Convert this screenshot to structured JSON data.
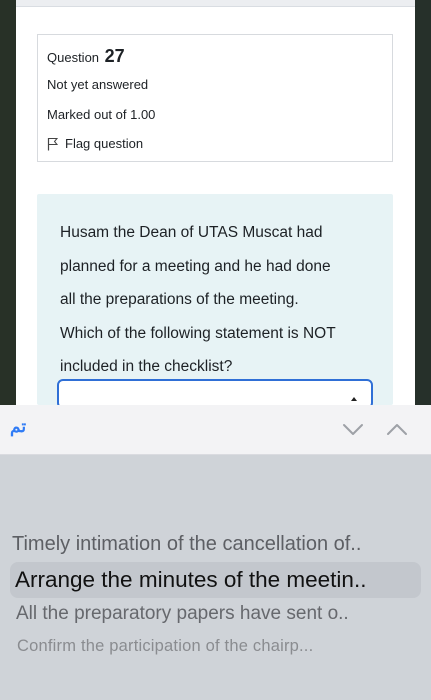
{
  "question": {
    "label": "Question",
    "number": "27",
    "status": "Not yet answered",
    "marks": "Marked out of 1.00",
    "flag_label": "Flag question",
    "text_lines": [
      "Husam the Dean of UTAS Muscat had",
      "planned for a meeting and he had done",
      "all the preparations of the meeting.",
      "Which of the following statement is NOT",
      "included in the checklist?"
    ]
  },
  "picker_toolbar": {
    "done_label": "تم",
    "prev_icon": "chevron-down-icon",
    "next_icon": "chevron-up-icon",
    "accent": "#2f7bf5"
  },
  "picker_options": [
    "Timely intimation of the cancellation of..",
    "Arrange the minutes of the meetin..",
    "All the preparatory papers have sent o..",
    "Confirm the participation of the chairp..."
  ],
  "selected_option_index": 1
}
